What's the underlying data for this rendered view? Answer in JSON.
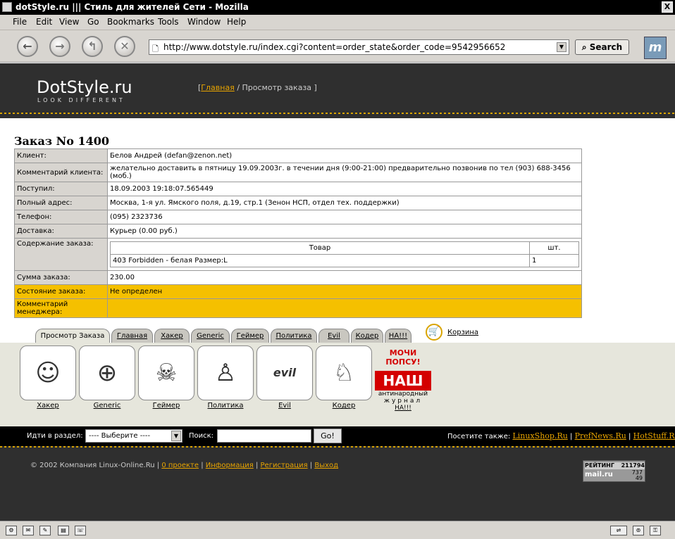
{
  "window": {
    "title": "dotStyle.ru ||| Стиль для жителей Сети - Mozilla",
    "close": "X"
  },
  "menu": [
    "File",
    "Edit",
    "View",
    "Go",
    "Bookmarks",
    "Tools",
    "Window",
    "Help"
  ],
  "nav": {
    "url": "http://www.dotstyle.ru/index.cgi?content=order_state&order_code=9542956652",
    "search_label": "Search"
  },
  "site": {
    "logo": "DotStyle.ru",
    "tagline": "LOOK DIFFERENT",
    "crumb_open": "[",
    "crumb_home": "Главная",
    "crumb_current": "/ Просмотр заказа ]"
  },
  "order": {
    "title": "Заказ No 1400",
    "rows": [
      {
        "label": "Клиент:",
        "value": "Белов Андрей (defan@zenon.net)"
      },
      {
        "label": "Комментарий клиента:",
        "value": "желательно доставить в пятницу 19.09.2003г. в течении дня (9:00-21:00) предварительно позвонив по тел (903) 688-3456 (моб.)"
      },
      {
        "label": "Поступил:",
        "value": "18.09.2003 19:18:07.565449"
      },
      {
        "label": "Полный адрес:",
        "value": "Москва, 1-я ул. Ямского поля, д.19, стр.1 (Зенон НСП, отдел тех. поддержки)"
      },
      {
        "label": "Телефон:",
        "value": "(095) 2323736"
      },
      {
        "label": "Доставка:",
        "value": "Курьер (0.00 руб.)"
      }
    ],
    "content_label": "Содержание заказа:",
    "items_header": {
      "product": "Товар",
      "qty": "шт."
    },
    "items": [
      {
        "product": "403 Forbidden - белая Размер:L",
        "qty": "1"
      }
    ],
    "sum_label": "Сумма заказа:",
    "sum_value": "230.00",
    "state_label": "Состояние заказа:",
    "state_value": "Не определен",
    "manager_label": "Комментарий менеджера:",
    "manager_value": ""
  },
  "tabs": [
    "Просмотр Заказа",
    "Главная",
    "Хакер",
    "Generic",
    "Геймер",
    "Политика",
    "Evil",
    "Кодер",
    "НА!!!"
  ],
  "cart_label": "Корзина",
  "sections": [
    "Хакер",
    "Generic",
    "Геймер",
    "Политика",
    "Evil",
    "Кодер"
  ],
  "nash": {
    "motto": "МОЧИ ПОПСУ!",
    "logo": "НАШ",
    "sub1": "антинародный",
    "sub2": "журнал",
    "link": "НА!!!"
  },
  "bottom": {
    "goto_label": "Идти в раздел:",
    "select_value": "---- Выберите ----",
    "search_label": "Поиск:",
    "go_label": "Go!",
    "visit_label": "Посетите также:",
    "links": [
      "LinuxShop.Ru",
      "PrefNews.Ru",
      "HotStuff.Ru"
    ]
  },
  "footer": {
    "copyright": "© 2002 Компания Linux-Online.Ru",
    "links": [
      "0 проекте",
      "Информация",
      "Регистрация",
      "Выход"
    ],
    "counter_label": "РЕЙТИНГ",
    "counter_value": "211794",
    "counter_brand": "mail.ru",
    "counter_v2": "737",
    "counter_v3": "49"
  }
}
